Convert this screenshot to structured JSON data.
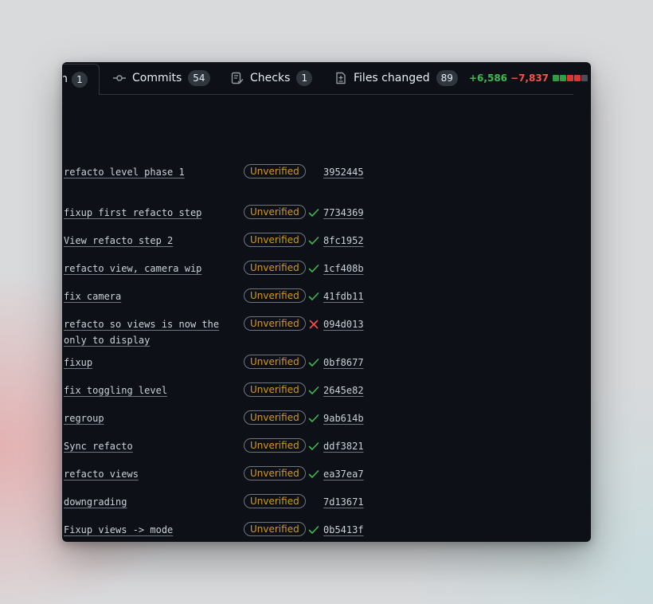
{
  "tabs": {
    "conversation": {
      "label": "n",
      "count": "1"
    },
    "commits": {
      "label": "Commits",
      "count": "54",
      "icon": "git-commit-icon"
    },
    "checks": {
      "label": "Checks",
      "count": "1",
      "icon": "checklist-icon"
    },
    "files": {
      "label": "Files changed",
      "count": "89",
      "icon": "file-diff-icon"
    }
  },
  "diffstat": {
    "additions": "+6,586",
    "deletions": "−7,837",
    "blocks": [
      "green",
      "green",
      "red",
      "red",
      "gray"
    ],
    "colors": {
      "green": "#2ea043",
      "red": "#da3633",
      "gray": "#484f58"
    }
  },
  "colors": {
    "success": "#3fb950",
    "failure": "#f85149",
    "unverified": "#d29922"
  },
  "commits": [
    {
      "message": "refacto level phase 1",
      "badge": "Unverified",
      "status": "none",
      "sha": "3952445"
    },
    {
      "message": "fixup first refacto step",
      "badge": "Unverified",
      "status": "success",
      "sha": "7734369"
    },
    {
      "message": "View refacto step 2",
      "badge": "Unverified",
      "status": "success",
      "sha": "8fc1952"
    },
    {
      "message": "refacto view, camera wip",
      "badge": "Unverified",
      "status": "success",
      "sha": "1cf408b"
    },
    {
      "message": "fix camera",
      "badge": "Unverified",
      "status": "success",
      "sha": "41fdb11"
    },
    {
      "message": "refacto so views is now the only to display",
      "badge": "Unverified",
      "status": "failure",
      "sha": "094d013"
    },
    {
      "message": "fixup",
      "badge": "Unverified",
      "status": "success",
      "sha": "0bf8677"
    },
    {
      "message": "fix toggling level",
      "badge": "Unverified",
      "status": "success",
      "sha": "2645e82"
    },
    {
      "message": "regroup",
      "badge": "Unverified",
      "status": "success",
      "sha": "9ab614b"
    },
    {
      "message": "Sync refacto",
      "badge": "Unverified",
      "status": "success",
      "sha": "ddf3821"
    },
    {
      "message": "refacto views",
      "badge": "Unverified",
      "status": "success",
      "sha": "ea37ea7"
    },
    {
      "message": "downgrading",
      "badge": "Unverified",
      "status": "none",
      "sha": "7d13671"
    },
    {
      "message": "Fixup views -> mode",
      "badge": "Unverified",
      "status": "success",
      "sha": "0b5413f"
    }
  ]
}
